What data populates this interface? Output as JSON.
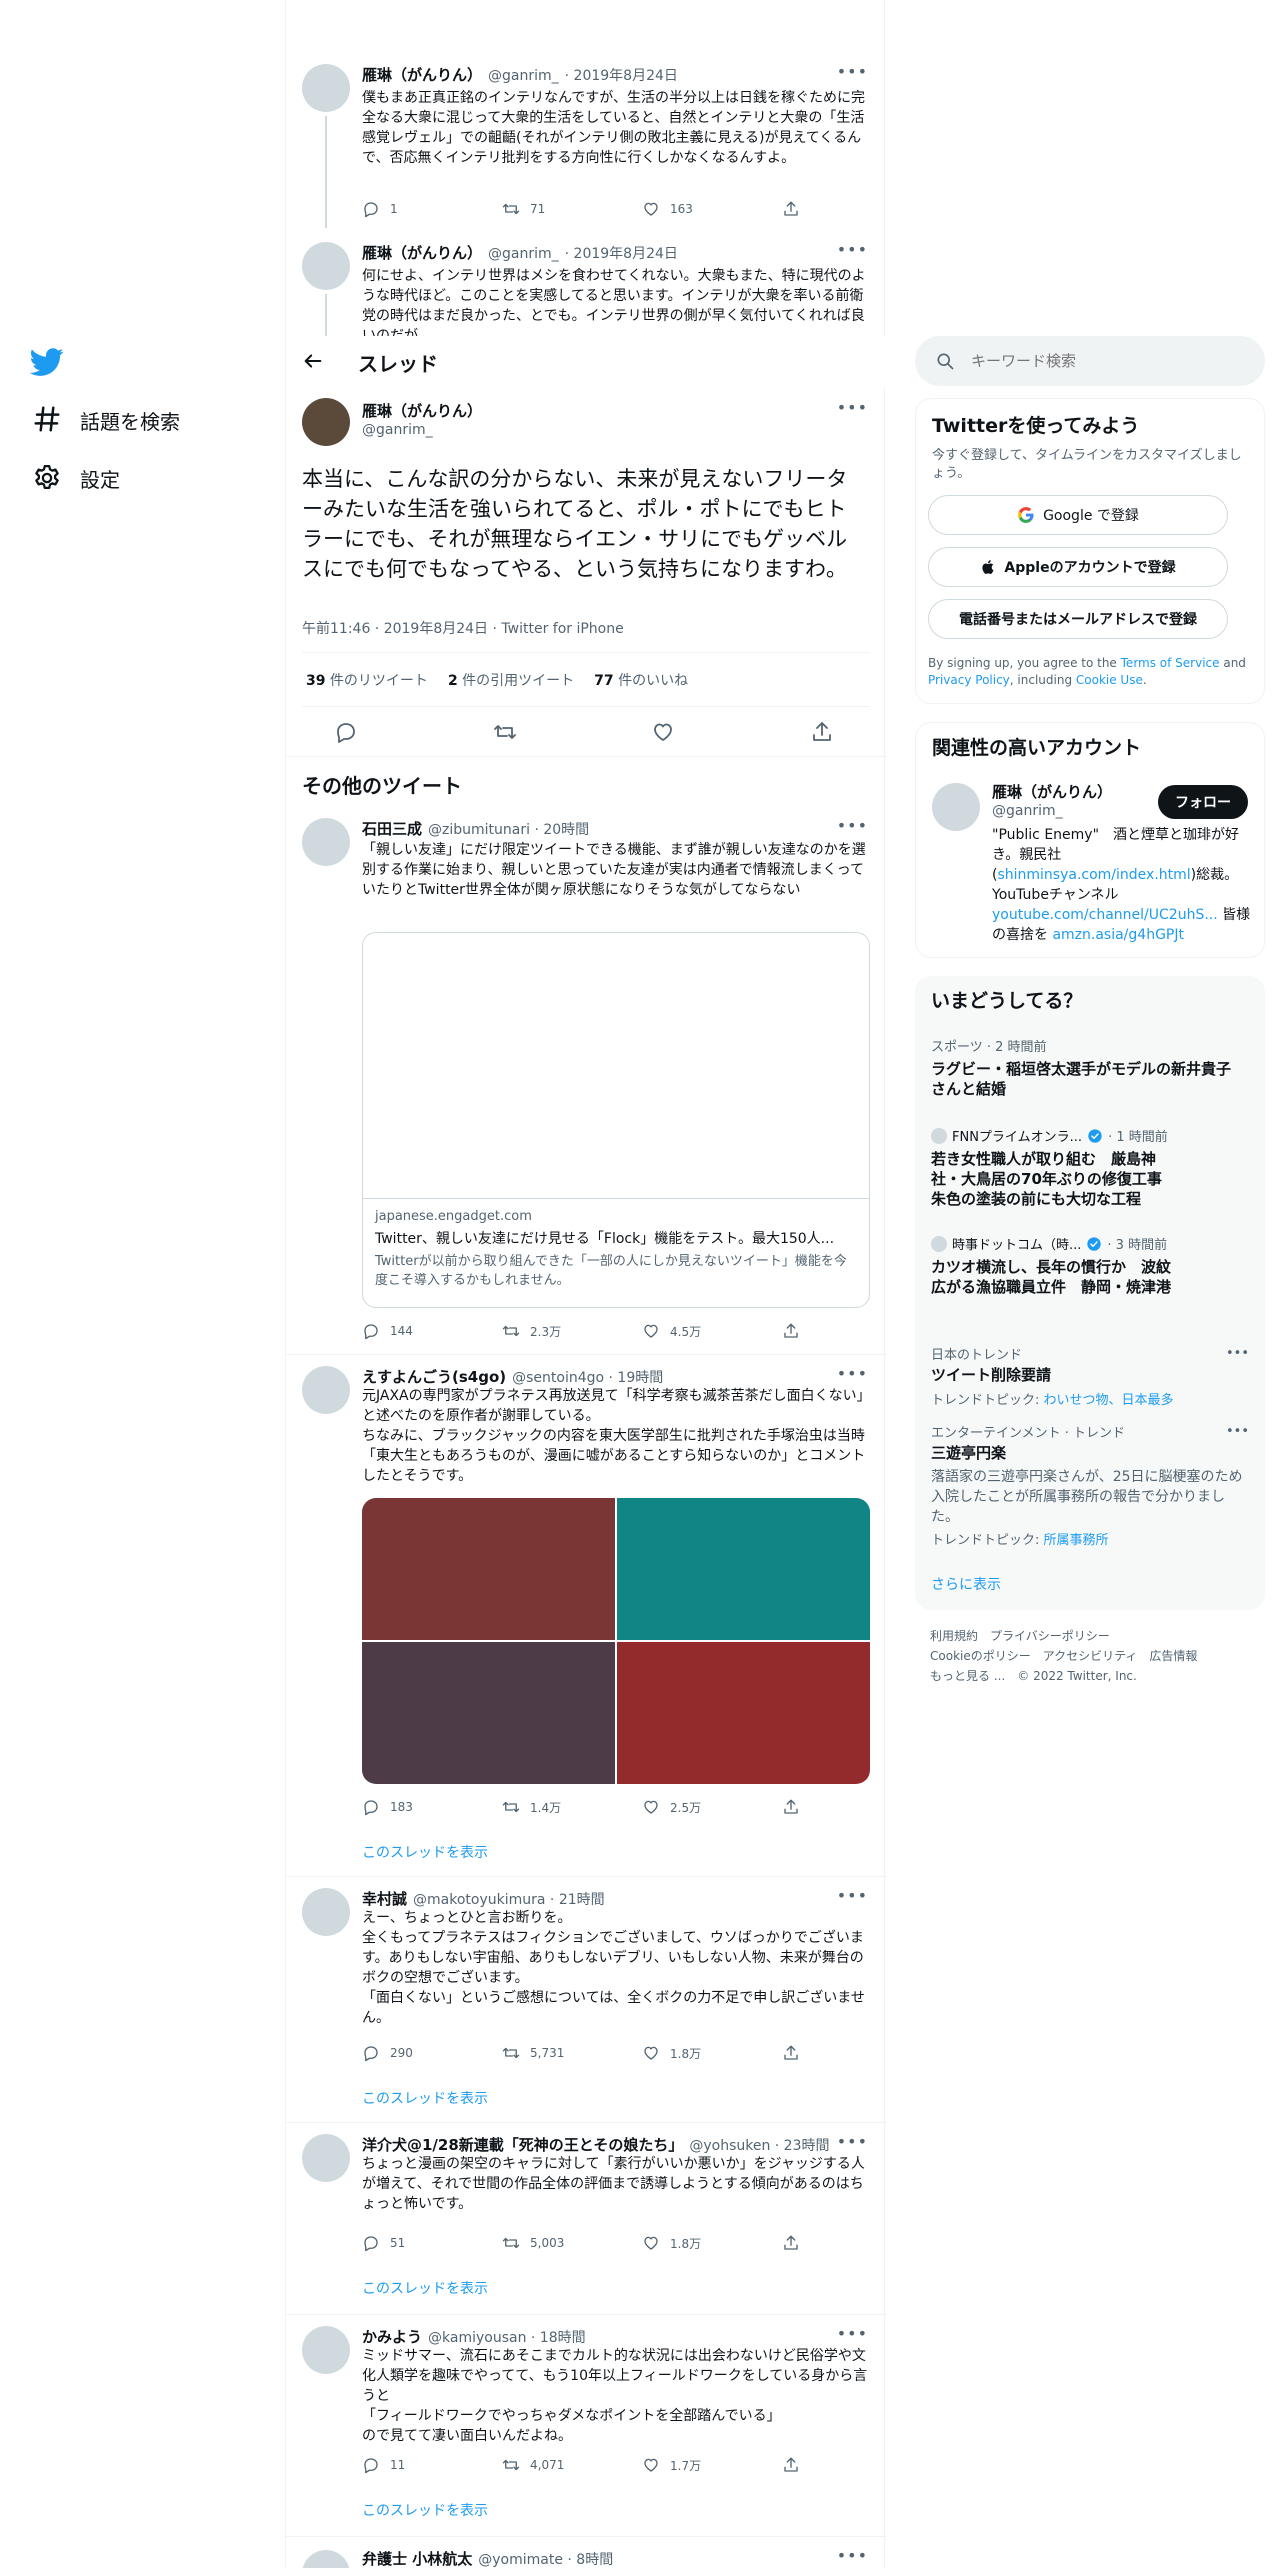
{
  "sidebar": {
    "items": [
      {
        "label": "話題を検索",
        "icon": "hashtag-icon"
      },
      {
        "label": "設定",
        "icon": "gear-icon"
      }
    ]
  },
  "header": {
    "title": "スレッド"
  },
  "context_tweets": [
    {
      "name": "雁琳（がんりん）",
      "handle": "@ganrim_",
      "date": "· 2019年8月24日",
      "text": "僕もまあ正真正銘のインテリなんですが、生活の半分以上は日銭を稼ぐために完全なる大衆に混じって大衆的生活をしていると、自然とインテリと大衆の「生活感覚レヴェル」での齟齬(それがインテリ側の敗北主義に見える)が見えてくるんで、否応無くインテリ批判をする方向性に行くしかなくなるんすよ。",
      "replies": "1",
      "retweets": "71",
      "likes": "163"
    },
    {
      "name": "雁琳（がんりん）",
      "handle": "@ganrim_",
      "date": "· 2019年8月24日",
      "text": "何にせよ、インテリ世界はメシを食わせてくれない。大衆もまた、特に現代のような時代ほど。このことを実感してると思います。インテリが大衆を率いる前衛党の時代はまだ良かった、とでも。インテリ世界の側が早く気付いてくれれば良いのだが"
    }
  ],
  "main_tweet": {
    "name": "雁琳（がんりん）",
    "handle": "@ganrim_",
    "text": "本当に、こんな訳の分からない、未来が見えないフリーターみたいな生活を強いられてると、ポル・ポトにでもヒトラーにでも、それが無理ならイエン・サリにでもゲッベルスにでも何でもなってやる、という気持ちになりますわ。",
    "meta": "午前11:46 · 2019年8月24日 · Twitter for iPhone",
    "retweets_num": "39",
    "retweets_label": " 件のリツイート",
    "quotes_num": "2",
    "quotes_label": " 件の引用ツイート",
    "likes_num": "77",
    "likes_label": " 件のいいね"
  },
  "more_tweets_heading": "その他のツイート",
  "show_thread": "このスレッドを表示",
  "tweets": [
    {
      "name": "石田三成",
      "handle": "@zibumitunari · 20時間",
      "text": "「親しい友達」にだけ限定ツイートできる機能、まず誰が親しい友達なのかを選別する作業に始まり、親しいと思っていた友達が実は内通者で情報流しまくっていたりとTwitter世界全体が関ヶ原状態になりそうな気がしてならない",
      "card": {
        "domain": "japanese.engadget.com",
        "title": "Twitter、親しい友達にだけ見せる「Flock」機能をテスト。最大150人...",
        "desc": "Twitterが以前から取り組んできた「一部の人にしか見えないツイート」機能を今度こそ導入するかもしれません。"
      },
      "replies": "144",
      "retweets": "2.3万",
      "likes": "4.5万"
    },
    {
      "name": "えすよんごう(s4go)",
      "handle": "@sentoin4go · 19時間",
      "text": "元JAXAの専門家がプラネテス再放送見て「科学考察も滅茶苦茶だし面白くない」と述べたのを原作者が謝罪している。\nちなみに、ブラックジャックの内容を東大医学部生に批判された手塚治虫は当時「東大生ともあろうものが、漫画に嘘があることすら知らないのか」とコメントしたとそうです。",
      "image_colors": [
        "#7a3535",
        "#0f8585",
        "#4d3c48",
        "#932b2c"
      ],
      "replies": "183",
      "retweets": "1.4万",
      "likes": "2.5万"
    },
    {
      "name": "幸村誠",
      "handle": "@makotoyukimura · 21時間",
      "text": "えー、ちょっとひと言お断りを。\n全くもってプラネテスはフィクションでございまして、ウソばっかりでございます。ありもしない宇宙船、ありもしないデブリ、いもしない人物、未来が舞台のボクの空想でございます。\n「面白くない」というご感想については、全くボクの力不足で申し訳ございません。",
      "replies": "290",
      "retweets": "5,731",
      "likes": "1.8万"
    },
    {
      "name": "洋介犬@1/28新連載「死神の王とその娘たち」",
      "handle": "@yohsuken · 23時間",
      "text": "ちょっと漫画の架空のキャラに対して「素行がいいか悪いか」をジャッジする人が増えて、それで世間の作品全体の評価まで誘導しようとする傾向があるのはちょっと怖いです。",
      "replies": "51",
      "retweets": "5,003",
      "likes": "1.8万"
    },
    {
      "name": "かみよう",
      "handle": "@kamiyousan · 18時間",
      "text": "ミッドサマー、流石にあそこまでカルト的な状況には出会わないけど民俗学や文化人類学を趣味でやってて、もう10年以上フィールドワークをしている身から言うと\n「フィールドワークでやっちゃダメなポイントを全部踏んでいる」\nので見てて凄い面白いんだよね。",
      "replies": "11",
      "retweets": "4,071",
      "likes": "1.7万"
    },
    {
      "name": "弁護士 小林航太",
      "handle": "@yomimate · 8時間"
    }
  ],
  "search": {
    "placeholder": "キーワード検索"
  },
  "signup": {
    "title": "Twitterを使ってみよう",
    "subtitle": "今すぐ登録して、タイムラインをカスタマイズしましょう。",
    "google": "Google で登録",
    "apple": "Appleのアカウントで登録",
    "phone": "電話番号またはメールアドレスで登録",
    "legal_1": "By signing up, you agree to the ",
    "legal_tos": "Terms of Service",
    "legal_2": " and ",
    "legal_privacy": "Privacy Policy",
    "legal_3": ", including ",
    "legal_cookie": "Cookie Use",
    "legal_4": "."
  },
  "related": {
    "title": "関連性の高いアカウント",
    "name": "雁琳（がんりん）",
    "handle": "@ganrim_",
    "follow": "フォロー",
    "bio_1": "\"Public Enemy\"　酒と煙草と珈琲が好き。親民社(",
    "bio_link1": "shinminsya.com/index.html",
    "bio_2": ")総裁。YouTubeチャンネル",
    "bio_link2": "youtube.com/channel/UC2uhS...",
    "bio_3": " 皆様の喜捨を ",
    "bio_link3": "amzn.asia/g4hGPJt"
  },
  "trends": {
    "title": "いまどうしてる？",
    "items": [
      {
        "meta": "スポーツ · 2 時間前",
        "title": "ラグビー・稲垣啓太選手がモデルの新井貴子さんと結婚"
      },
      {
        "source": "FNNプライムオンラ...",
        "time": " · 1 時間前",
        "title": "若き女性職人が取り組む　厳島神社・大鳥居の70年ぶりの修復工事　朱色の塗装の前にも大切な工程"
      },
      {
        "source": "時事ドットコム（時...",
        "time": " · 3 時間前",
        "title": "カツオ横流し、長年の慣行か　波紋広がる漁協職員立件　静岡・焼津港"
      },
      {
        "meta": "日本のトレンド",
        "title": "ツイート削除要請",
        "topics_label": "トレンドトピック: ",
        "topics": "わいせつ物、日本最多"
      },
      {
        "meta": "エンターテインメント · トレンド",
        "title": "三遊亭円楽",
        "desc": "落語家の三遊亭円楽さんが、25日に脳梗塞のため入院したことが所属事務所の報告で分かりました。",
        "topics_label": "トレンドトピック: ",
        "topics": "所属事務所"
      }
    ],
    "show_more": "さらに表示"
  },
  "footer": {
    "row1": [
      "利用規約",
      "プライバシーポリシー"
    ],
    "row2": [
      "Cookieのポリシー",
      "アクセシビリティ",
      "広告情報"
    ],
    "more": "もっと見る ...",
    "copyright": "© 2022 Twitter, Inc."
  },
  "colors": {
    "accent": "#1d9bf0",
    "text": "#0f1419",
    "secondary": "#536471"
  }
}
